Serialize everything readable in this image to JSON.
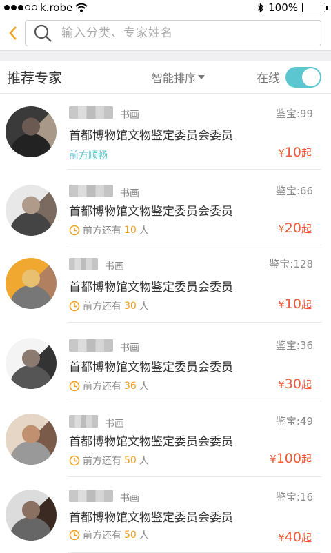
{
  "status_bar": {
    "carrier": "k.robe",
    "battery": "100%"
  },
  "search": {
    "placeholder": "输入分类、专家姓名"
  },
  "list_header": {
    "title": "推荐专家",
    "sort_label": "智能排序",
    "online_label": "在线",
    "online_enabled": true
  },
  "accent_colors": {
    "teal": "#5bc6cf",
    "price_red": "#f05a3a",
    "queue_orange": "#f0a020",
    "back_orange": "#f5a623"
  },
  "experts": [
    {
      "category": "书画",
      "appraisal_label": "鉴宝:",
      "appraisal_count": "99",
      "organization": "首都博物馆文物鉴定委员会委员",
      "queue_text": "前方顺畅",
      "queue_prefix": "",
      "queue_number": "",
      "queue_suffix": "",
      "currency": "¥",
      "price": "10",
      "price_suffix": "起"
    },
    {
      "category": "书画",
      "appraisal_label": "鉴宝:",
      "appraisal_count": "66",
      "organization": "首都博物馆文物鉴定委员会委员",
      "queue_text": "",
      "queue_prefix": "前方还有",
      "queue_number": "10",
      "queue_suffix": "人",
      "currency": "¥",
      "price": "20",
      "price_suffix": "起"
    },
    {
      "category": "书画",
      "appraisal_label": "鉴宝:",
      "appraisal_count": "128",
      "organization": "首都博物馆文物鉴定委员会委员",
      "queue_text": "",
      "queue_prefix": "前方还有",
      "queue_number": "30",
      "queue_suffix": "人",
      "currency": "¥",
      "price": "10",
      "price_suffix": "起"
    },
    {
      "category": "书画",
      "appraisal_label": "鉴宝:",
      "appraisal_count": "36",
      "organization": "首都博物馆文物鉴定委员会委员",
      "queue_text": "",
      "queue_prefix": "前方还有",
      "queue_number": "36",
      "queue_suffix": "人",
      "currency": "¥",
      "price": "30",
      "price_suffix": "起"
    },
    {
      "category": "书画",
      "appraisal_label": "鉴宝:",
      "appraisal_count": "49",
      "organization": "首都博物馆文物鉴定委员会委员",
      "queue_text": "",
      "queue_prefix": "前方还有",
      "queue_number": "50",
      "queue_suffix": "人",
      "currency": "¥",
      "price": "100",
      "price_suffix": "起"
    },
    {
      "category": "书画",
      "appraisal_label": "鉴宝:",
      "appraisal_count": "16",
      "organization": "首都博物馆文物鉴定委员会委员",
      "queue_text": "",
      "queue_prefix": "前方还有",
      "queue_number": "50",
      "queue_suffix": "人",
      "currency": "¥",
      "price": "40",
      "price_suffix": "起"
    }
  ]
}
